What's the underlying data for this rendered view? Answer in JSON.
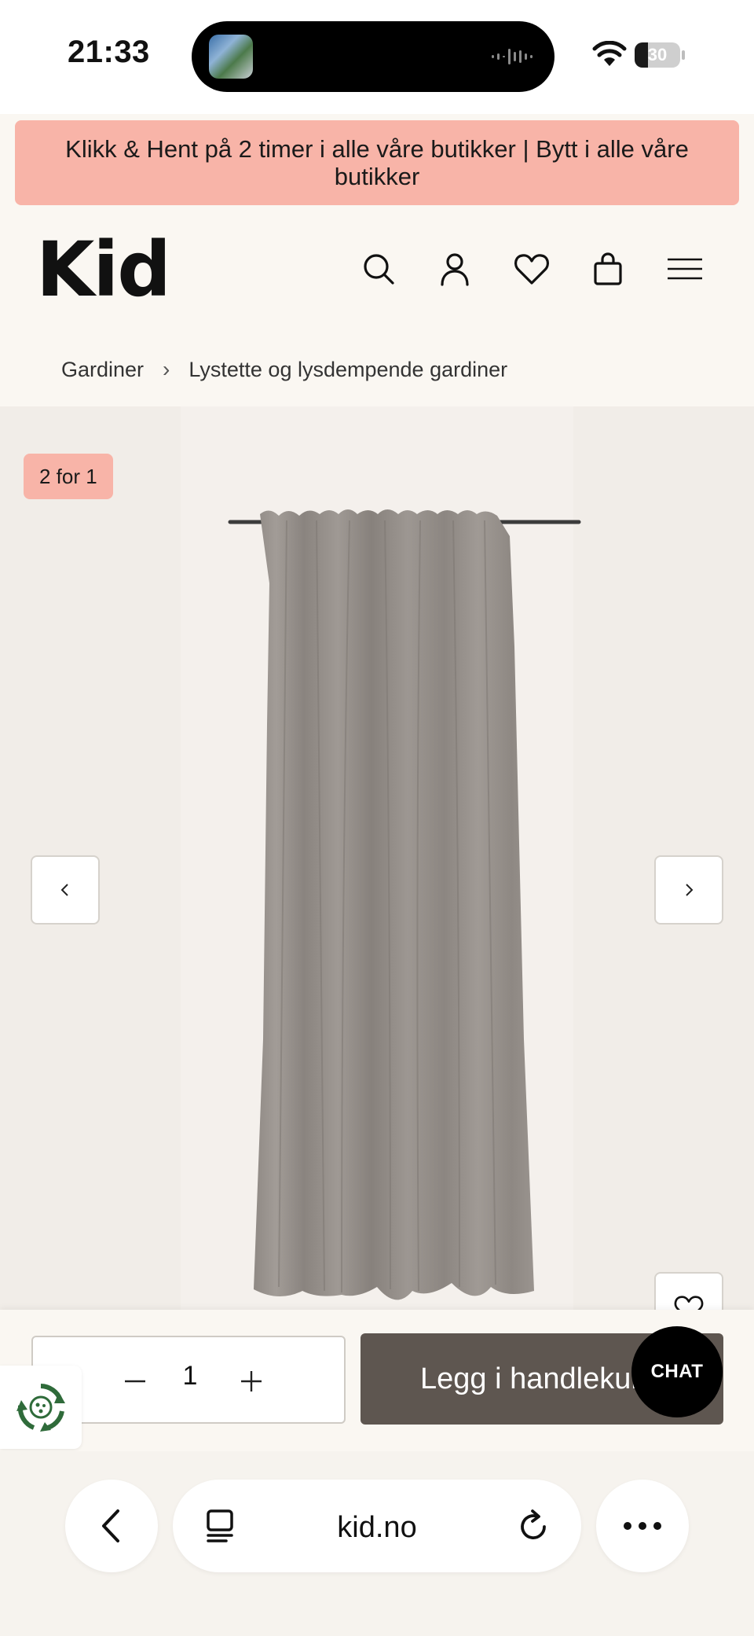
{
  "status_bar": {
    "time": "21:33",
    "battery_level": "30",
    "battery_fraction": 0.3,
    "icons": [
      "island-app-thumbnail",
      "audio-wave-icon",
      "wifi-icon",
      "battery-icon"
    ]
  },
  "promo_banner": {
    "text": "Klikk & Hent på 2 timer i alle våre butikker | Bytt i alle våre butikker",
    "color": "#f8b4a8"
  },
  "header": {
    "logo": "Kid",
    "icons": [
      "search-icon",
      "account-icon",
      "heart-icon",
      "bag-icon",
      "menu-icon"
    ]
  },
  "breadcrumb": {
    "items": [
      "Gardiner",
      "Lystette og lysdempende gardiner"
    ],
    "separator": "›"
  },
  "gallery": {
    "badge": "2 for 1",
    "image": "grey-curtain-on-rod",
    "prev_icon": "chevron-left-icon",
    "next_icon": "chevron-right-icon",
    "wishlist_icon": "heart-icon"
  },
  "purchase_bar": {
    "quantity": "1",
    "minus_icon": "minus-icon",
    "plus_icon": "plus-icon",
    "add_to_cart_label": "Legg i handlekurv",
    "chat_label": "CHAT",
    "eco_icon": "recycle-icon",
    "button_color": "#5e5650"
  },
  "browser": {
    "url": "kid.no",
    "icons": [
      "back-icon",
      "tabs-icon",
      "reload-icon",
      "more-icon"
    ]
  }
}
